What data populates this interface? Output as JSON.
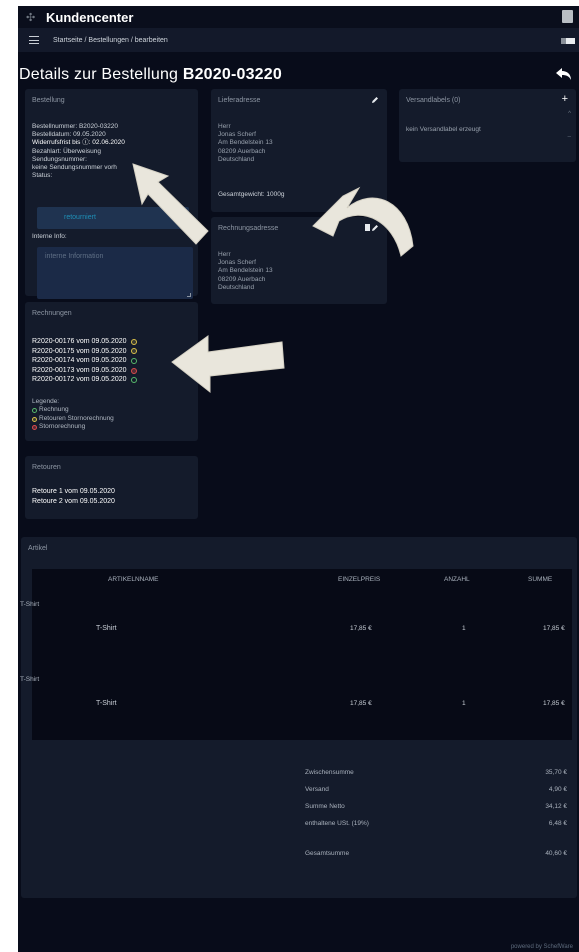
{
  "app": {
    "title": "Kundencenter",
    "breadcrumb": "Startseite / Bestellungen / bearbeiten",
    "footer": "powered by SchefWare"
  },
  "page": {
    "title_prefix": "Details zur Bestellung",
    "order_number": "B2020-03220"
  },
  "order": {
    "card_title": "Bestellung",
    "lines": [
      "Bestellnummer: B2020-03220",
      "Bestelldatum: 09.05.2020",
      "Widerrufsfrist bis ⓘ: 02.06.2020",
      "Bezahlart: Überweisung",
      "Sendungsnummer:",
      "keine Sendungsnummer vorh",
      "Status:"
    ],
    "status_value": "retourniert",
    "notes_label": "Interne Info:",
    "notes_placeholder": "interne Information"
  },
  "delivery": {
    "card_title": "Lieferadresse",
    "lines": [
      "Herr",
      "Jonas Scherf",
      "Am Bendelstein 13",
      "08209 Auerbach",
      "Deutschland"
    ],
    "weight_label": "Gesamtgewicht: 1000g"
  },
  "billing": {
    "card_title": "Rechnungsadresse",
    "lines": [
      "Herr",
      "Jonas Scherf",
      "Am Bendelstein 13",
      "08209 Auerbach",
      "Deutschland"
    ]
  },
  "labels": {
    "card_title": "Versandlabels (0)",
    "empty_text": "kein Versandlabel erzeugt"
  },
  "invoices": {
    "card_title": "Rechnungen",
    "items": [
      {
        "text": "R2020-00176 vom 09.05.2020",
        "kind": "yellow"
      },
      {
        "text": "R2020-00175 vom 09.05.2020",
        "kind": "yellow"
      },
      {
        "text": "R2020-00174 vom 09.05.2020",
        "kind": "green"
      },
      {
        "text": "R2020-00173 vom 09.05.2020",
        "kind": "red"
      },
      {
        "text": "R2020-00172 vom 09.05.2020",
        "kind": "green"
      }
    ],
    "legend_title": "Legende:",
    "legend": [
      {
        "text": "Rechnung",
        "kind": "green"
      },
      {
        "text": "Retouren Stornorechnung",
        "kind": "yellow"
      },
      {
        "text": "Stornorechnung",
        "kind": "red"
      }
    ]
  },
  "returns": {
    "card_title": "Retouren",
    "items": [
      "Retoure 1 vom 09.05.2020",
      "Retoure 2 vom 09.05.2020"
    ]
  },
  "articles": {
    "card_title": "Artikel",
    "headers": {
      "name": "ARTIKELNNAME",
      "unit_price": "EINZELPREIS",
      "qty": "ANZAHL",
      "sum": "SUMME"
    },
    "groups": [
      {
        "label": "T-Shirt",
        "row": {
          "name": "T-Shirt",
          "unit_price": "17,85 €",
          "qty": "1",
          "sum": "17,85 €"
        }
      },
      {
        "label": "T-Shirt",
        "row": {
          "name": "T-Shirt",
          "unit_price": "17,85 €",
          "qty": "1",
          "sum": "17,85 €"
        }
      }
    ],
    "totals": [
      {
        "label": "Zwischensumme",
        "value": "35,70 €"
      },
      {
        "label": "Versand",
        "value": "4,90 €"
      },
      {
        "label": "Summe Netto",
        "value": "34,12 €"
      },
      {
        "label": "enthaltene USt. (19%)",
        "value": "6,48 €"
      }
    ],
    "grand_total": {
      "label": "Gesamtsumme",
      "value": "40,60 €"
    }
  },
  "colors": {
    "background": "#080c1a",
    "card": "#141b2b",
    "status_text": "#1f8fb6",
    "paid": "#57b96b",
    "return_credit": "#d9c04a",
    "cancel": "#d94b4b"
  }
}
